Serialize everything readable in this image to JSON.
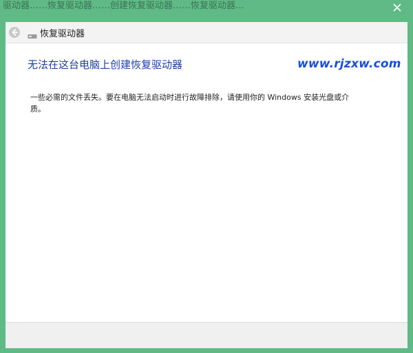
{
  "window": {
    "title_partial": "驱动器……恢复驱动器……创建恢复驱动器……恢复驱动器…",
    "close_icon": "close-icon",
    "frame_color": "#5fba86"
  },
  "nav": {
    "back_icon": "back-arrow-icon",
    "drive_icon": "usb-drive-icon",
    "title": "恢复驱动器"
  },
  "content": {
    "heading": "无法在这台电脑上创建恢复驱动器",
    "watermark": "www.rjzxw.com",
    "message": "一些必需的文件丢失。要在电脑无法启动时进行故障排除，请使用你的 Windows 安装光盘或介质。"
  },
  "colors": {
    "heading": "#1f3fa6",
    "watermark": "#1a4fd8"
  }
}
